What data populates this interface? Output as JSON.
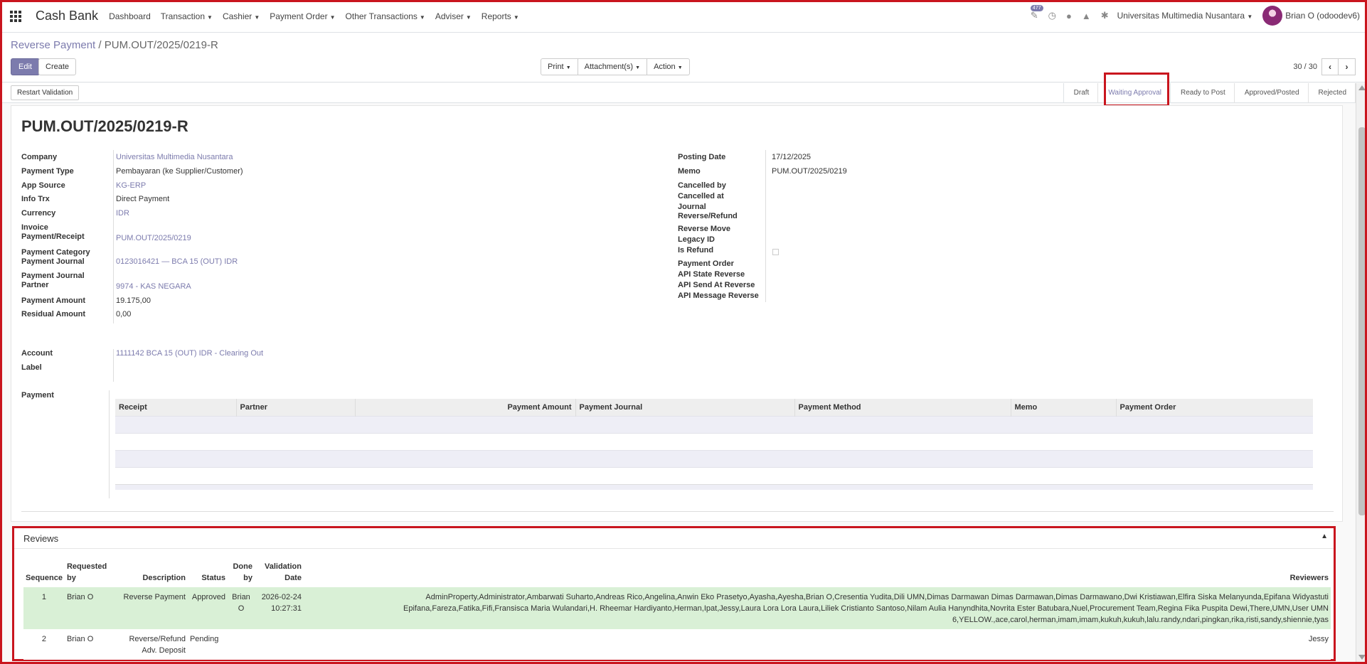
{
  "topbar": {
    "brand": "Cash Bank",
    "menu": [
      "Dashboard",
      "Transaction",
      "Cashier",
      "Payment Order",
      "Other Transactions",
      "Adviser",
      "Reports"
    ],
    "activity_badge": "477",
    "company": "Universitas Multimedia Nusantara",
    "user": "Brian O (odoodev6)",
    "icons": [
      "apps-grid-icon",
      "activity-icon",
      "clock-icon",
      "chat-icon",
      "bell-icon",
      "bug-icon"
    ]
  },
  "control_panel": {
    "breadcrumb_parent": "Reverse Payment",
    "breadcrumb_sep": "/",
    "breadcrumb_current": "PUM.OUT/2025/0219-R",
    "edit_label": "Edit",
    "create_label": "Create",
    "print_label": "Print",
    "attachments_label": "Attachment(s)",
    "action_label": "Action",
    "pager": "30 / 30"
  },
  "statusbar": {
    "restart_label": "Restart Validation",
    "stages": [
      "Draft",
      "Waiting Approval",
      "Ready to Post",
      "Approved/Posted",
      "Rejected"
    ],
    "active_stage": "Waiting Approval"
  },
  "record": {
    "title": "PUM.OUT/2025/0219-R",
    "left_fields": [
      {
        "label": "Company",
        "value": "Universitas Multimedia Nusantara"
      },
      {
        "label": "Payment Type",
        "value": "Pembayaran (ke Supplier/Customer)"
      },
      {
        "label": "App Source",
        "value": "KG-ERP"
      },
      {
        "label": "Info Trx",
        "value": "Direct Payment"
      },
      {
        "label": "Currency",
        "value": "IDR"
      },
      {
        "label": "Invoice Payment/Receipt",
        "value": "PUM.OUT/2025/0219"
      },
      {
        "label": "Payment Category",
        "value": ""
      },
      {
        "label": "Payment Journal",
        "value": "0123016421 — BCA 15 (OUT) IDR"
      },
      {
        "label": "Payment Journal Partner",
        "value": "9974 - KAS NEGARA"
      },
      {
        "label": "Payment Amount",
        "value": "19.175,00"
      },
      {
        "label": "Residual Amount",
        "value": "0,00"
      },
      {
        "label": "Account",
        "value": "1111142 BCA 15 (OUT) IDR - Clearing Out"
      },
      {
        "label": "Label",
        "value": ""
      },
      {
        "label": "Payment",
        "value": ""
      }
    ],
    "right_fields": [
      {
        "label": "Posting Date",
        "value": "17/12/2025"
      },
      {
        "label": "Memo",
        "value": "PUM.OUT/2025/0219"
      },
      {
        "label": "Cancelled by",
        "value": ""
      },
      {
        "label": "Cancelled at",
        "value": ""
      },
      {
        "label": "Journal Reverse/Refund",
        "value": ""
      },
      {
        "label": "Reverse Move",
        "value": ""
      },
      {
        "label": "Legacy ID",
        "value": ""
      },
      {
        "label": "Is Refund",
        "value": ""
      },
      {
        "label": "Payment Order",
        "value": ""
      },
      {
        "label": "API State Reverse",
        "value": ""
      },
      {
        "label": "API Send At Reverse",
        "value": ""
      },
      {
        "label": "API Message Reverse",
        "value": ""
      }
    ],
    "payment_table_headers": [
      "Receipt",
      "Partner",
      "Payment Amount",
      "Payment Journal",
      "Payment Method",
      "Memo",
      "Payment Order"
    ]
  },
  "reviews": {
    "title": "Reviews",
    "headers": [
      "Sequence",
      "Requested by",
      "Description",
      "Status",
      "Done by",
      "Validation Date",
      "Reviewers"
    ],
    "rows": [
      {
        "sequence": "1",
        "requested_by": "Brian O",
        "description": "Reverse Payment",
        "status": "Approved",
        "done_by": "Brian O",
        "validation_date": "2026-02-24 10:27:31",
        "reviewers": "AdminProperty,Administrator,Ambarwati Suharto,Andreas Rico,Angelina,Anwin Eko Prasetyo,Ayasha,Ayesha,Brian O,Cresentia Yudita,Dili UMN,Dimas Darmawan Dimas Darmawan,Dimas Darmawano,Dwi Kristiawan,Elfira Siska Melanyunda,Epifana Widyastuti Epifana,Fareza,Fatika,Fifi,Fransisca Maria Wulandari,H. Rheemar Hardiyanto,Herman,Ipat,Jessy,Laura Lora Lora Laura,Liliek Cristianto Santoso,Nilam Aulia Hanyndhita,Novrita Ester Batubara,Nuel,Procurement Team,Regina Fika Puspita Dewi,There,UMN,User UMN 6,YELLOW.,ace,carol,herman,imam,imam,kukuh,kukuh,lalu.randy,ndari,pingkan,rika,risti,sandy,shiennie,tyas"
      },
      {
        "sequence": "2",
        "requested_by": "Brian O",
        "description": "Reverse/Refund Adv. Deposit",
        "status": "Pending",
        "done_by": "",
        "validation_date": "",
        "reviewers": "Jessy"
      }
    ]
  },
  "colors": {
    "accent": "#7c7bad",
    "highlight": "#c9151e",
    "approved_row": "#d9f0d6"
  }
}
